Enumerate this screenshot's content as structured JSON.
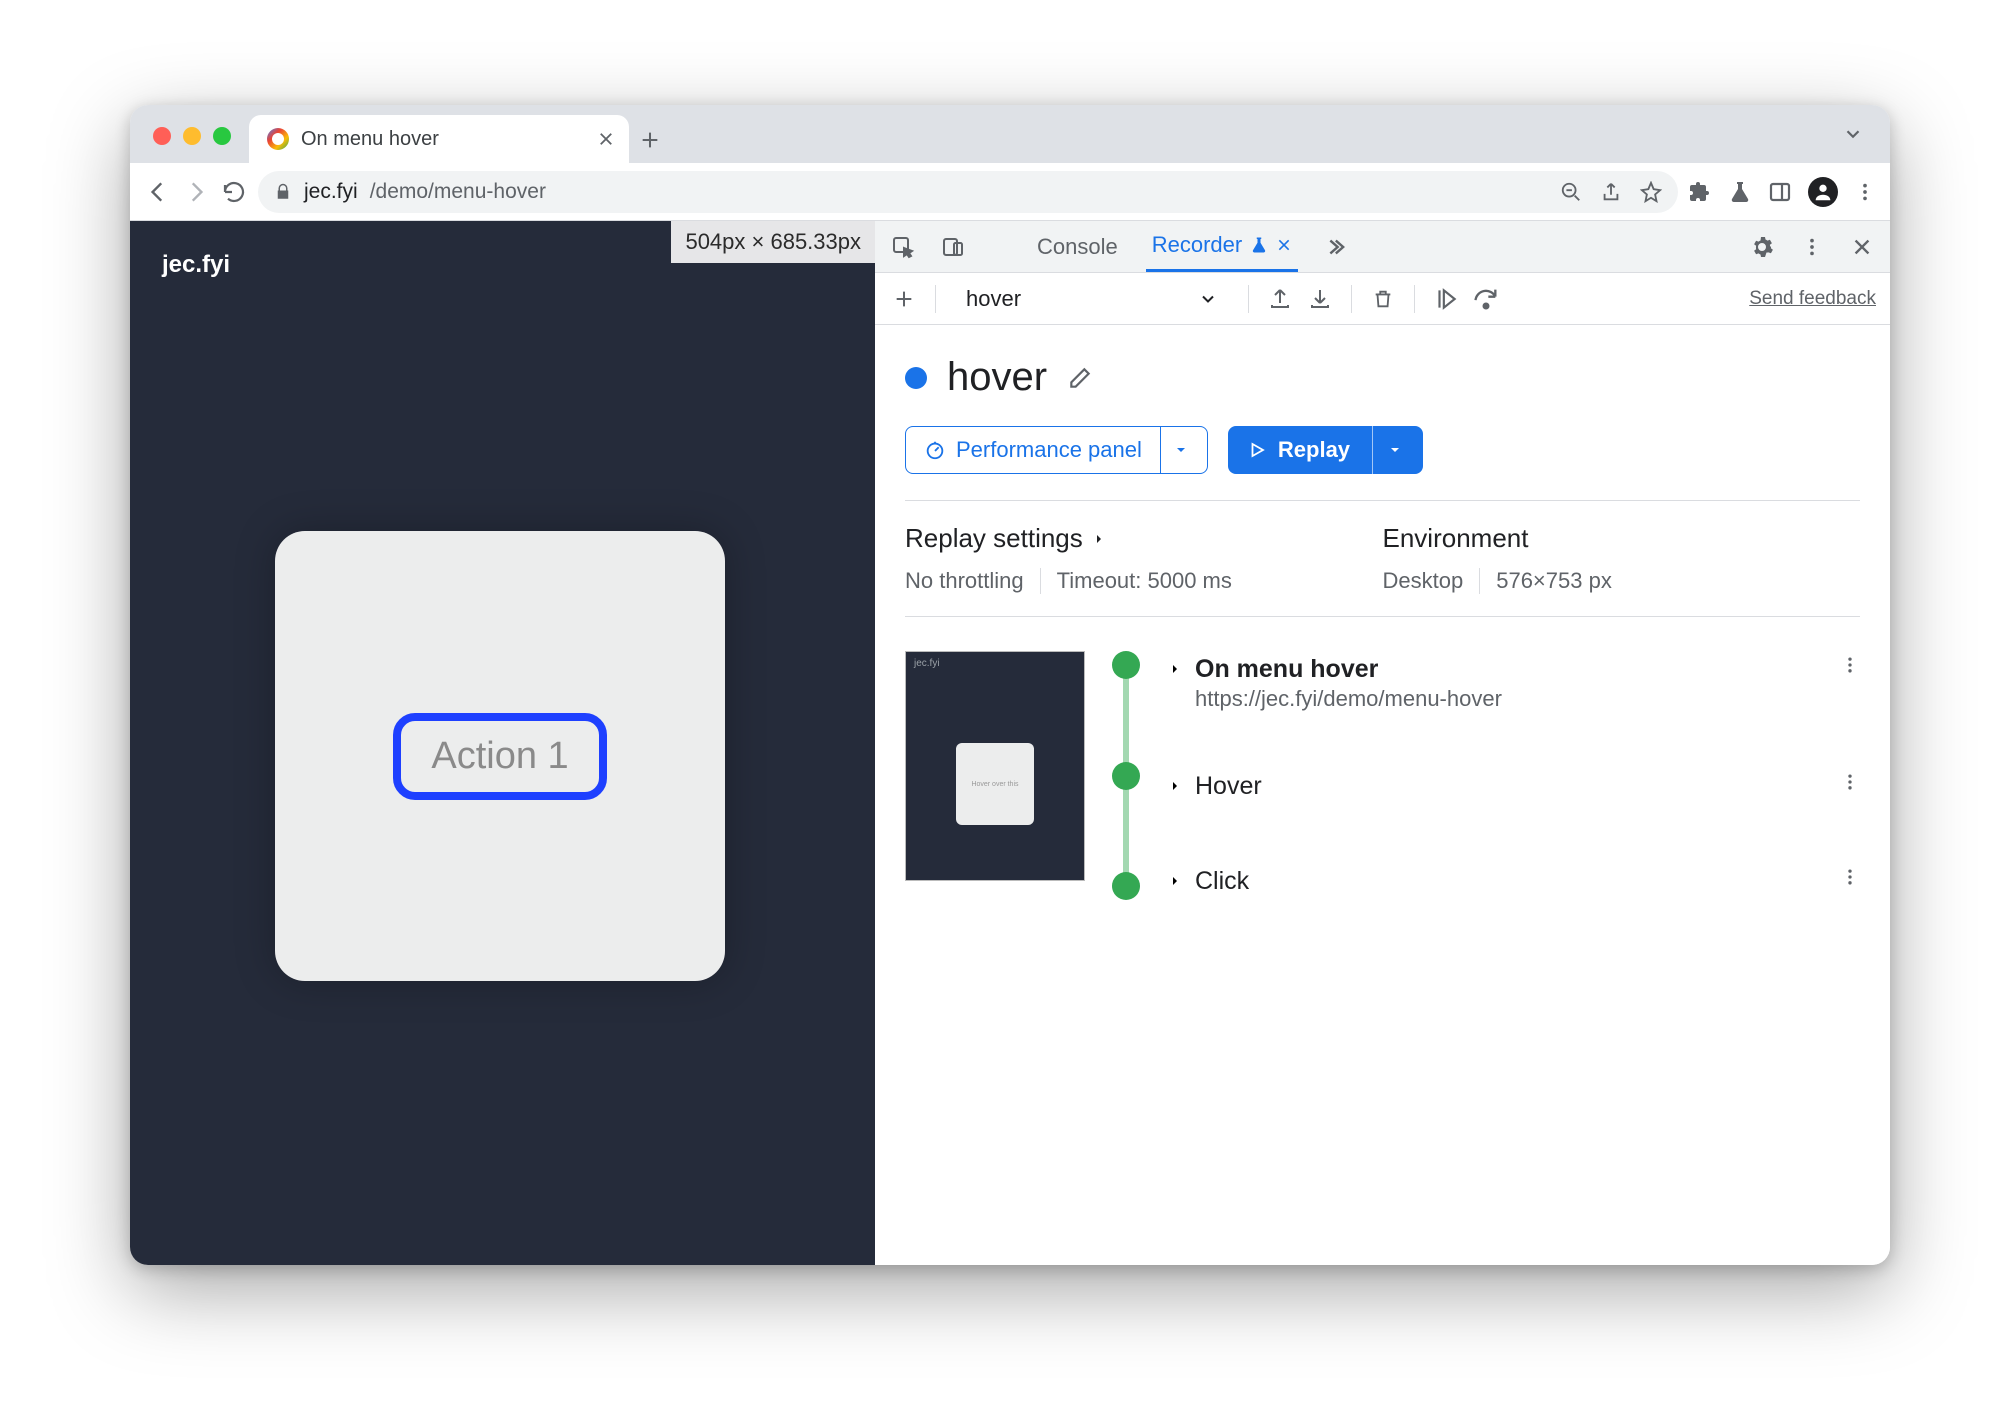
{
  "browser": {
    "tab_title": "On menu hover",
    "url_host": "jec.fyi",
    "url_path": "/demo/menu-hover"
  },
  "page": {
    "site_title": "jec.fyi",
    "dim_overlay": "504px × 685.33px",
    "action_button": "Action 1"
  },
  "devtools": {
    "tabs": {
      "console": "Console",
      "recorder": "Recorder"
    },
    "toolbar": {
      "recording_select": "hover",
      "feedback": "Send feedback"
    },
    "recording": {
      "title": "hover",
      "perf_btn": "Performance panel",
      "replay_btn": "Replay"
    },
    "settings": {
      "replay_head": "Replay settings",
      "env_head": "Environment",
      "throttling": "No throttling",
      "timeout": "Timeout: 5000 ms",
      "device": "Desktop",
      "viewport": "576×753 px"
    },
    "steps": {
      "s1_title": "On menu hover",
      "s1_url": "https://jec.fyi/demo/menu-hover",
      "s2_title": "Hover",
      "s3_title": "Click",
      "thumb_text": "Hover over this"
    }
  }
}
